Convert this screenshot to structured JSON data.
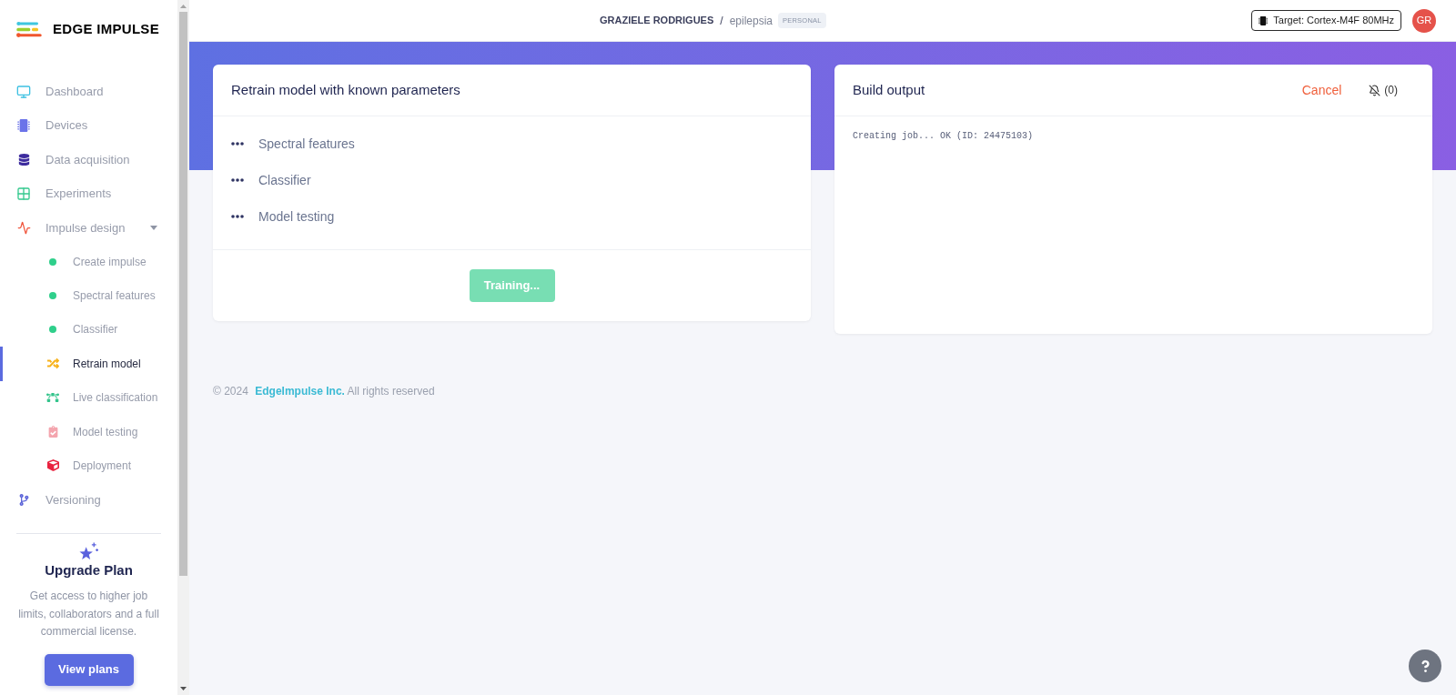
{
  "sidebar": {
    "logo": "EDGE IMPULSE",
    "items": [
      {
        "label": "Dashboard",
        "selected": false
      },
      {
        "label": "Devices",
        "selected": false
      },
      {
        "label": "Data acquisition",
        "selected": false
      },
      {
        "label": "Experiments",
        "selected": false
      },
      {
        "label": "Impulse design",
        "selected": false,
        "expanded": true,
        "children": [
          {
            "label": "Create impulse",
            "kind": "block",
            "selected": false
          },
          {
            "label": "Spectral features",
            "kind": "block",
            "selected": false
          },
          {
            "label": "Classifier",
            "kind": "block",
            "selected": false
          },
          {
            "label": "Retrain model",
            "kind": "page",
            "selected": true
          },
          {
            "label": "Live classification",
            "kind": "page",
            "selected": false
          },
          {
            "label": "Model testing",
            "kind": "page",
            "selected": false
          },
          {
            "label": "Deployment",
            "kind": "page",
            "selected": false
          }
        ]
      },
      {
        "label": "Versioning",
        "selected": false
      }
    ],
    "upgrade": {
      "title": "Upgrade Plan",
      "description": "Get access to higher job limits, collaborators and a full commercial license.",
      "button": "View plans"
    }
  },
  "top_bar": {
    "owner": "GRAZIELE RODRIGUES",
    "separator": "/",
    "project": "epilepsia",
    "badge": "PERSONAL",
    "target": "Target: Cortex-M4F 80MHz",
    "avatar": "GR"
  },
  "retrain_card": {
    "title": "Retrain model with known parameters",
    "steps": [
      {
        "label": "Spectral features",
        "done": false
      },
      {
        "label": "Classifier",
        "done": false
      },
      {
        "label": "Model testing",
        "done": false
      }
    ],
    "button": {
      "label": "Training...",
      "disabled": true
    }
  },
  "build_output": {
    "title": "Build output",
    "cancel": "Cancel",
    "notifications": "(0)",
    "log": [
      "Creating job... OK (ID: 24475103)"
    ]
  },
  "footer": {
    "copyright": "© 2024",
    "link": "EdgeImpulse Inc.",
    "rights": "All rights reserved"
  }
}
